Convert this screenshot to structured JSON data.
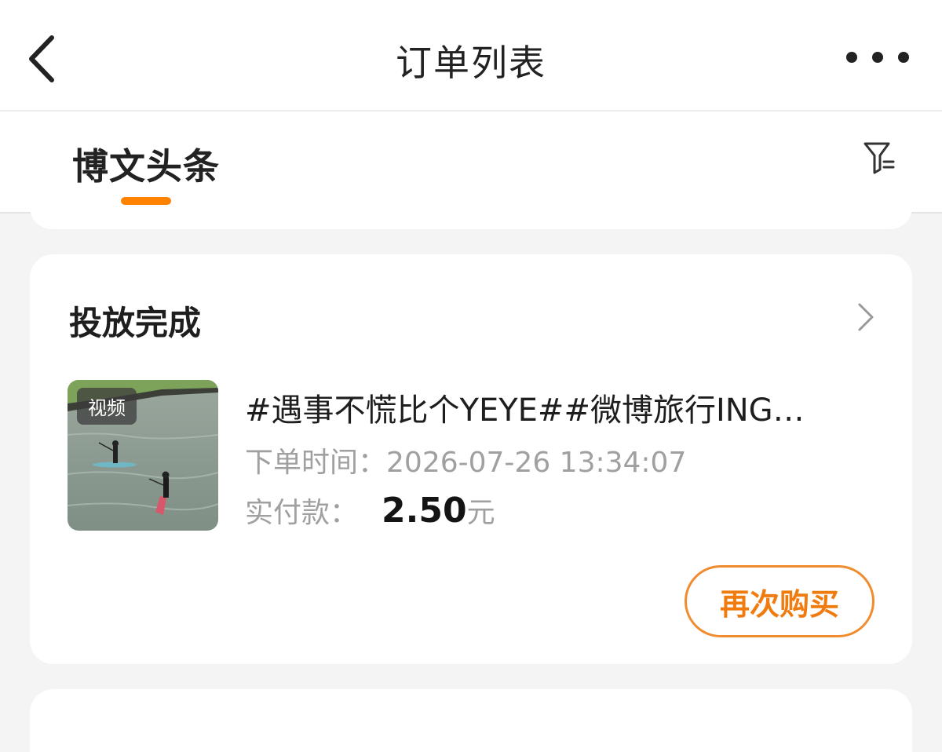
{
  "header": {
    "title": "订单列表",
    "back_icon": "back-arrow-icon",
    "more_icon": "more-dots-icon"
  },
  "tabs": {
    "items": [
      {
        "label": "博文头条",
        "active": true
      }
    ],
    "filter_icon": "filter-icon",
    "accent": "#ff8200"
  },
  "order": {
    "status": "投放完成",
    "thumb_badge": "视频",
    "title": "#遇事不慌比个YEYE##微博旅行ING…",
    "time_label": "下单时间：",
    "time_value": "2026-07-26 13:34:07",
    "pay_label": "实付款：",
    "pay_amount": "2.50",
    "pay_unit": "元",
    "rebuy_label": "再次购买"
  },
  "colors": {
    "accent": "#ff8200",
    "button_border": "#f08c2d",
    "muted_text": "#a0a0a0",
    "background": "#f4f4f4"
  }
}
